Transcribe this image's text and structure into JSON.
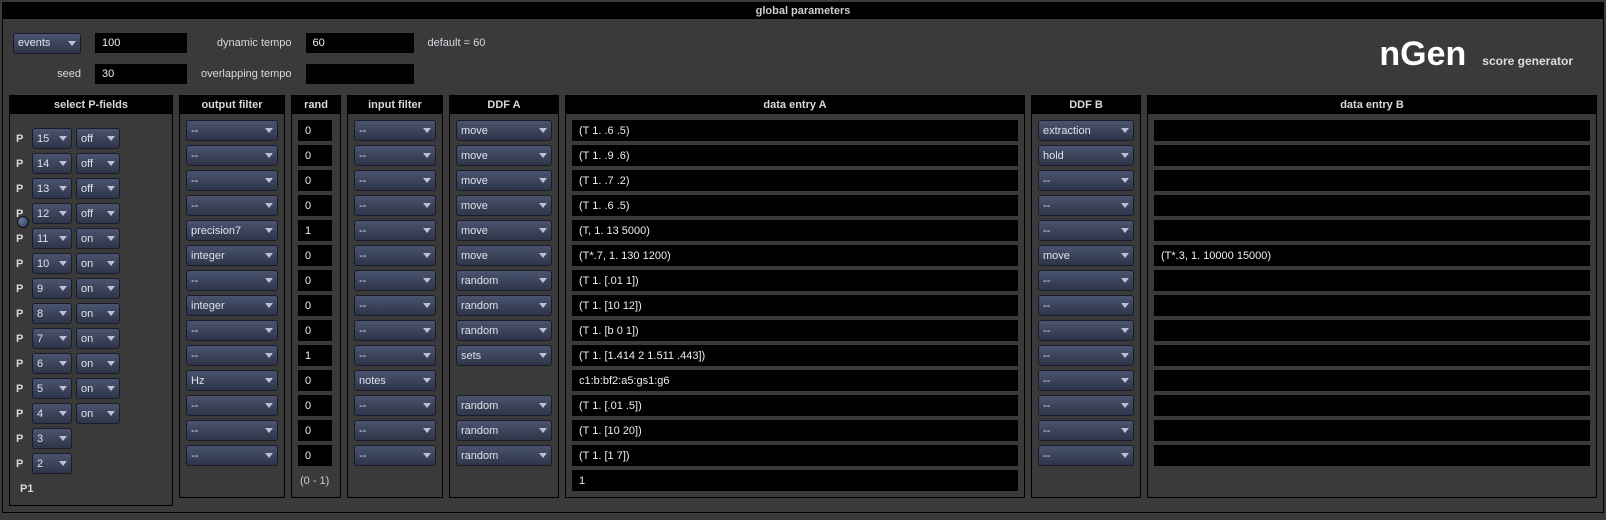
{
  "header": {
    "title": "global parameters"
  },
  "brand": {
    "name": "nGen",
    "sub": "score generator"
  },
  "top": {
    "events_label": "events",
    "events_value": "100",
    "dyn_tempo_label": "dynamic tempo",
    "dyn_tempo_value": "60",
    "default_hint": "default = 60",
    "seed_label": "seed",
    "seed_value": "30",
    "ovl_tempo_label": "overlapping tempo",
    "ovl_tempo_value": ""
  },
  "panels": {
    "pfields": "select P-fields",
    "outfilter": "output filter",
    "rand": "rand",
    "infilter": "input filter",
    "ddfa": "DDF A",
    "dataa": "data entry A",
    "ddfb": "DDF B",
    "datab": "data entry B"
  },
  "rows": [
    {
      "p": "15",
      "onoff": "off",
      "of": "--",
      "rand": "0",
      "if": "--",
      "ddfa": "move",
      "da": "(T 1. .6 .5)",
      "ddfb": "extraction",
      "db": ""
    },
    {
      "p": "14",
      "onoff": "off",
      "of": "--",
      "rand": "0",
      "if": "--",
      "ddfa": "move",
      "da": "(T 1. .9 .6)",
      "ddfb": "hold",
      "db": ""
    },
    {
      "p": "13",
      "onoff": "off",
      "of": "--",
      "rand": "0",
      "if": "--",
      "ddfa": "move",
      "da": "(T 1. .7 .2)",
      "ddfb": "--",
      "db": ""
    },
    {
      "p": "12",
      "onoff": "off",
      "of": "--",
      "rand": "0",
      "if": "--",
      "ddfa": "move",
      "da": "(T 1. .6 .5)",
      "ddfb": "--",
      "db": ""
    },
    {
      "p": "11",
      "onoff": "on",
      "of": "precision7",
      "rand": "1",
      "if": "--",
      "ddfa": "move",
      "da": "(T, 1. 13 5000)",
      "ddfb": "--",
      "db": ""
    },
    {
      "p": "10",
      "onoff": "on",
      "of": "integer",
      "rand": "0",
      "if": "--",
      "ddfa": "move",
      "da": "(T*.7, 1. 130 1200)",
      "ddfb": "move",
      "db": "(T*.3, 1. 10000 15000)"
    },
    {
      "p": "9",
      "onoff": "on",
      "of": "--",
      "rand": "0",
      "if": "--",
      "ddfa": "random",
      "da": "(T 1. [.01 1])",
      "ddfb": "--",
      "db": ""
    },
    {
      "p": "8",
      "onoff": "on",
      "of": "integer",
      "rand": "0",
      "if": "--",
      "ddfa": "random",
      "da": "(T 1. [10 12])",
      "ddfb": "--",
      "db": ""
    },
    {
      "p": "7",
      "onoff": "on",
      "of": "--",
      "rand": "0",
      "if": "--",
      "ddfa": "random",
      "da": "(T 1. [b 0 1])",
      "ddfb": "--",
      "db": ""
    },
    {
      "p": "6",
      "onoff": "on",
      "of": "--",
      "rand": "1",
      "if": "--",
      "ddfa": "sets",
      "da": "(T 1. [1.414 2 1.511 .443])",
      "ddfb": "--",
      "db": ""
    },
    {
      "p": "5",
      "onoff": "on",
      "of": "Hz",
      "rand": "0",
      "if": "notes",
      "ddfa": "",
      "da": "c1:b:bf2:a5:gs1:g6",
      "ddfb": "--",
      "db": ""
    },
    {
      "p": "4",
      "onoff": "on",
      "of": "--",
      "rand": "0",
      "if": "--",
      "ddfa": "random",
      "da": "(T 1. [.01 .5])",
      "ddfb": "--",
      "db": ""
    },
    {
      "p": "3",
      "onoff": "",
      "of": "--",
      "rand": "0",
      "if": "--",
      "ddfa": "random",
      "da": "(T 1. [10 20])",
      "ddfb": "--",
      "db": ""
    },
    {
      "p": "2",
      "onoff": "",
      "of": "--",
      "rand": "0",
      "if": "--",
      "ddfa": "random",
      "da": "(T 1. [1 7])",
      "ddfb": "--",
      "db": ""
    }
  ],
  "footer": {
    "p1": "P1",
    "rand_range": "(0 - 1)",
    "dataa_value": "1"
  }
}
